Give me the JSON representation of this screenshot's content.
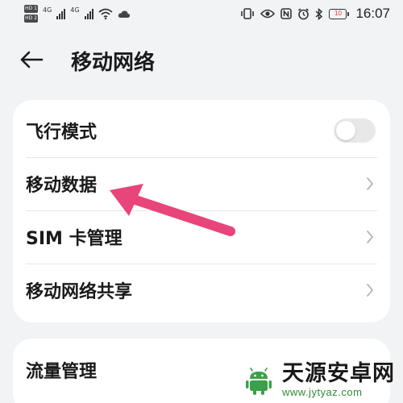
{
  "status_bar": {
    "sim1_badge": "HD 1",
    "sim2_badge": "HD 2",
    "network_type_1": "4G",
    "network_type_2": "4G",
    "battery_level": "10",
    "time": "16:07",
    "icons": [
      "sim-hd-icon",
      "signal-icon",
      "wifi-icon",
      "cloud-icon",
      "vibrate-icon",
      "eye-icon",
      "nfc-icon",
      "alarm-icon",
      "bluetooth-icon",
      "battery-icon"
    ]
  },
  "header": {
    "title": "移动网络",
    "back_icon": "arrow-left-icon"
  },
  "settings": {
    "items": [
      {
        "label": "飞行模式",
        "control": "toggle",
        "on": false
      },
      {
        "label": "移动数据",
        "control": "chevron"
      },
      {
        "label": "SIM 卡管理",
        "control": "chevron"
      },
      {
        "label": "移动网络共享",
        "control": "chevron"
      }
    ],
    "secondary_items": [
      {
        "label": "流量管理",
        "control": "chevron"
      }
    ]
  },
  "annotation": {
    "arrow_color": "#e8457a"
  },
  "watermark": {
    "name": "天源安卓网",
    "url": "www.jytyaz.com"
  },
  "colors": {
    "background": "#f1f3f5",
    "card": "#ffffff",
    "toggle_off": "#e8e8e8",
    "chevron": "#b5b5b5",
    "watermark_green": "#2e8b3a",
    "battery_low": "#e0403a"
  }
}
